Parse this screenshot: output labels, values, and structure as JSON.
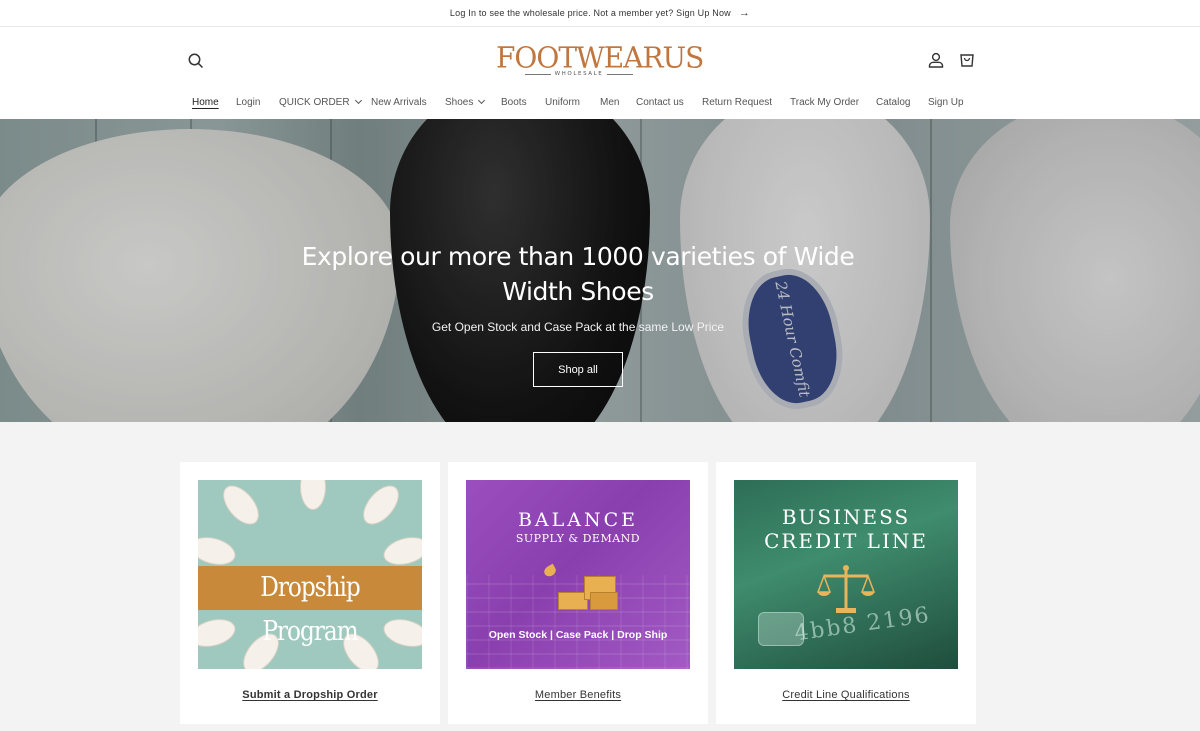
{
  "announcement": {
    "text": "Log In to see the wholesale price. Not a member yet? Sign Up Now",
    "arrow": "→"
  },
  "header": {
    "logo_name": "FOOTWEARUS",
    "logo_sub": "WHOLESALE",
    "icons": {
      "search": "search-icon",
      "account": "account-icon",
      "cart": "cart-icon"
    }
  },
  "nav": {
    "items": [
      {
        "label": "Home",
        "active": true
      },
      {
        "label": "Login"
      },
      {
        "label": "QUICK ORDER",
        "dropdown": true
      },
      {
        "label": "New Arrivals"
      },
      {
        "label": "Shoes",
        "dropdown": true
      },
      {
        "label": "Boots"
      },
      {
        "label": "Uniform"
      },
      {
        "label": "Men"
      },
      {
        "label": "Contact us"
      },
      {
        "label": "Return Request"
      },
      {
        "label": "Track My Order"
      },
      {
        "label": "Catalog"
      },
      {
        "label": "Sign Up"
      }
    ]
  },
  "hero": {
    "title": "Explore our more than 1000 varieties of Wide Width Shoes",
    "subtitle": "Get Open Stock and Case Pack at the same Low Price",
    "button": "Shop all",
    "insole_text": "24 Hour Comfit"
  },
  "cards": [
    {
      "image_text": "Dropship Program",
      "caption": "Submit a Dropship Order"
    },
    {
      "image_title": "BALANCE",
      "image_subtitle": "SUPPLY & DEMAND",
      "image_footer": "Open Stock | Case Pack | Drop Ship",
      "caption": "Member Benefits"
    },
    {
      "image_title": "BUSINESS CREDIT LINE",
      "image_digits": "4bb8 2196",
      "caption": "Credit Line Qualifications"
    }
  ],
  "colors": {
    "brand": "#c0773f",
    "dropship_band": "#c9893b",
    "purple": "#9b4fbf",
    "green": "#2d6e56"
  }
}
